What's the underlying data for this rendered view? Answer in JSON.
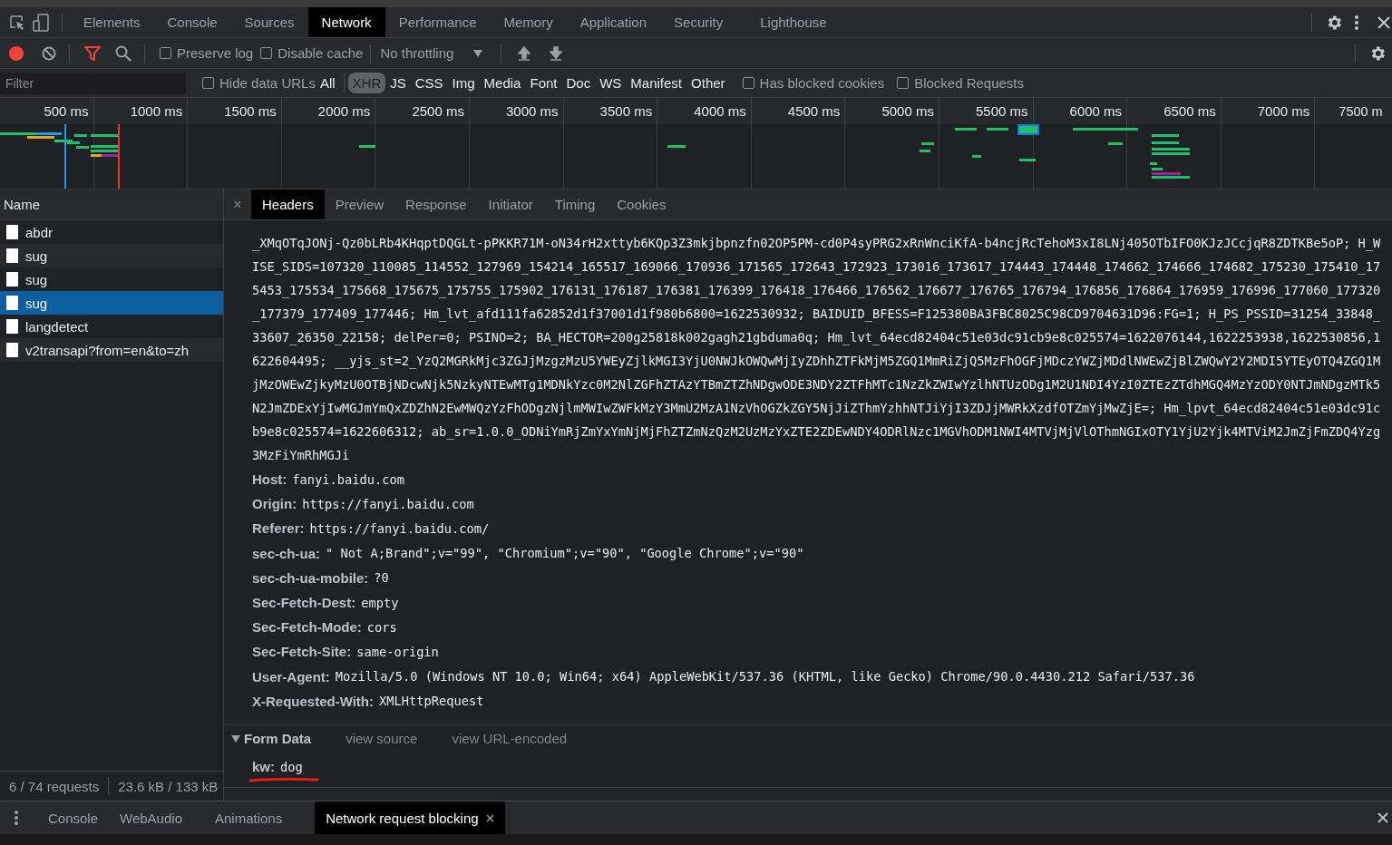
{
  "panel_tabs": [
    {
      "label": "Elements",
      "selected": false
    },
    {
      "label": "Console",
      "selected": false
    },
    {
      "label": "Sources",
      "selected": false
    },
    {
      "label": "Network",
      "selected": true
    },
    {
      "label": "Performance",
      "selected": false
    },
    {
      "label": "Memory",
      "selected": false
    },
    {
      "label": "Application",
      "selected": false
    },
    {
      "label": "Security",
      "selected": false
    },
    {
      "label": "Lighthouse",
      "selected": false
    }
  ],
  "toolbar": {
    "recording": true,
    "filter_active": true,
    "checkboxes": [
      {
        "label": "Preserve log",
        "checked": false
      },
      {
        "label": "Disable cache",
        "checked": false
      }
    ],
    "throttling": "No throttling"
  },
  "filter": {
    "placeholder": "Filter",
    "hide_data_urls": {
      "label": "Hide data URLs",
      "checked": false
    },
    "types": [
      {
        "label": "All",
        "selected": false
      },
      {
        "label": "XHR",
        "selected": true
      },
      {
        "label": "JS",
        "selected": false
      },
      {
        "label": "CSS",
        "selected": false
      },
      {
        "label": "Img",
        "selected": false
      },
      {
        "label": "Media",
        "selected": false
      },
      {
        "label": "Font",
        "selected": false
      },
      {
        "label": "Doc",
        "selected": false
      },
      {
        "label": "WS",
        "selected": false
      },
      {
        "label": "Manifest",
        "selected": false
      },
      {
        "label": "Other",
        "selected": false
      }
    ],
    "options": [
      {
        "label": "Has blocked cookies",
        "checked": false
      },
      {
        "label": "Blocked Requests",
        "checked": false
      }
    ]
  },
  "timeline": {
    "ticks": [
      "500 ms",
      "1000 ms",
      "1500 ms",
      "2000 ms",
      "2500 ms",
      "3000 ms",
      "3500 ms",
      "4000 ms",
      "4500 ms",
      "5000 ms",
      "5500 ms",
      "6000 ms",
      "6500 ms",
      "7000 ms",
      "7500 m"
    ]
  },
  "requests": {
    "column": "Name",
    "rows": [
      {
        "name": "abdr",
        "selected": false
      },
      {
        "name": "sug",
        "selected": false
      },
      {
        "name": "sug",
        "selected": false
      },
      {
        "name": "sug",
        "selected": true
      },
      {
        "name": "langdetect",
        "selected": false
      },
      {
        "name": "v2transapi?from=en&to=zh",
        "selected": false
      }
    ]
  },
  "details": {
    "close": "×",
    "tabs": [
      {
        "label": "Headers",
        "selected": true
      },
      {
        "label": "Preview",
        "selected": false
      },
      {
        "label": "Response",
        "selected": false
      },
      {
        "label": "Initiator",
        "selected": false
      },
      {
        "label": "Timing",
        "selected": false
      },
      {
        "label": "Cookies",
        "selected": false
      }
    ],
    "cookie_lines": [
      "_XMqOTqJONj-Qz0bLRb4KHqptDQGLt-pPKKR71M-oN34rH2xttyb6KQp3Z3mkjbpnzfn02OP5PM-cd0P4syPRG2xRnWnciKfA-b4ncjRcTehoM3xI8LNj405OTbIFO0KJzJCcjqR8ZDTKBe5oP; H_W",
      "ISE_SIDS=107320_110085_114552_127969_154214_165517_169066_170936_171565_172643_172923_173016_173617_174443_174448_174662_174666_174682_175230_175410_17",
      "5453_175534_175668_175675_175755_175902_176131_176187_176381_176399_176418_176466_176562_176677_176765_176794_176856_176864_176959_176996_177060_177320",
      "_177379_177409_177446; Hm_lvt_afd111fa62852d1f37001d1f980b6800=1622530932; BAIDUID_BFESS=F125380BA3FBC8025C98CD9704631D96:FG=1; H_PS_PSSID=31254_33848_",
      "33607_26350_22158; delPer=0; PSINO=2; BA_HECTOR=200g25818k002gagh21gbduma0q; Hm_lvt_64ecd82404c51e03dc91cb9e8c025574=1622076144,1622253938,1622530856,1",
      "622604495; __yjs_st=2_YzQ2MGRkMjc3ZGJjMzgzMzU5YWEyZjlkMGI3YjU0NWJkOWQwMjIyZDhhZTFkMjM5ZGQ1MmRiZjQ5MzFhOGFjMDczYWZjMDdlNWEwZjBlZWQwY2Y2MDI5YTEyOTQ4ZGQ1M",
      "jMzOWEwZjkyMzU0OTBjNDcwNjk5NzkyNTEwMTg1MDNkYzc0M2NlZGFhZTAzYTBmZTZhNDgwODE3NDY2ZTFhMTc1NzZkZWIwYzlhNTUzODg1M2U1NDI4YzI0ZTEzZTdhMGQ4MzYzODY0NTJmNDgzMTk5",
      "N2JmZDExYjIwMGJmYmQxZDZhN2EwMWQzYzFhODgzNjlmMWIwZWFkMzY3MmU2MzA1NzVhOGZkZGY5NjJiZThmYzhhNTJiYjI3ZDJjMWRkXzdfOTZmYjMwZjE=; Hm_lpvt_64ecd82404c51e03dc91c",
      "b9e8c025574=1622606312; ab_sr=1.0.0_ODNiYmRjZmYxYmNjMjFhZTZmNzQzM2UzMzYxZTE2ZDEwNDY4ODRlNzc1MGVhODM1NWI4MTVjMjVlOThmNGIxOTY1YjU2Yjk4MTViM2JmZjFmZDQ4Yzg",
      "3MzFiYmRhMGJi"
    ],
    "headers": [
      {
        "name": "Host:",
        "value": "fanyi.baidu.com"
      },
      {
        "name": "Origin:",
        "value": "https://fanyi.baidu.com"
      },
      {
        "name": "Referer:",
        "value": "https://fanyi.baidu.com/"
      },
      {
        "name": "sec-ch-ua:",
        "value": "\" Not A;Brand\";v=\"99\", \"Chromium\";v=\"90\", \"Google Chrome\";v=\"90\""
      },
      {
        "name": "sec-ch-ua-mobile:",
        "value": "?0"
      },
      {
        "name": "Sec-Fetch-Dest:",
        "value": "empty"
      },
      {
        "name": "Sec-Fetch-Mode:",
        "value": "cors"
      },
      {
        "name": "Sec-Fetch-Site:",
        "value": "same-origin"
      },
      {
        "name": "User-Agent:",
        "value": "Mozilla/5.0 (Windows NT 10.0; Win64; x64) AppleWebKit/537.36 (KHTML, like Gecko) Chrome/90.0.4430.212 Safari/537.36"
      },
      {
        "name": "X-Requested-With:",
        "value": "XMLHttpRequest"
      }
    ],
    "form_data": {
      "title": "Form Data",
      "expanded": true,
      "links": [
        "view source",
        "view URL-encoded"
      ],
      "fields": [
        {
          "name": "kw:",
          "value": "dog"
        }
      ]
    }
  },
  "status": [
    "6 / 74 requests",
    "23.6 kB / 133 kB"
  ],
  "drawer_tabs": [
    {
      "label": "Console",
      "selected": false,
      "closable": false
    },
    {
      "label": "WebAudio",
      "selected": false,
      "closable": false
    },
    {
      "label": "Animations",
      "selected": false,
      "closable": false
    },
    {
      "label": "Network request blocking",
      "selected": true,
      "closable": true
    }
  ]
}
